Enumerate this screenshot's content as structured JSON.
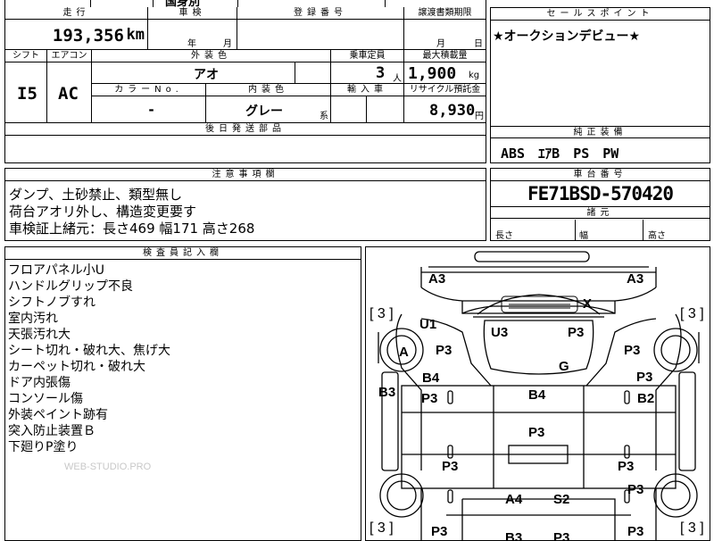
{
  "top_fragment": "国身別",
  "vehicle": {
    "labels": {
      "mileage": "走行",
      "inspection": "車検",
      "registration": "登録番号",
      "transfer_deadline": "譲渡書類期限",
      "shift": "シフト",
      "aircon": "エアコン",
      "exterior_color": "外装色",
      "seating": "乗車定員",
      "max_load": "最大積載量",
      "color_no": "カラーNo.",
      "interior_color": "内装色",
      "import": "輸入車",
      "recycle": "リサイクル預託金",
      "later_parts": "後日発送部品"
    },
    "mileage": "193,356",
    "mileage_unit": "km",
    "inspection_year_unit": "年",
    "inspection_month_unit": "月",
    "transfer_month_unit": "月",
    "transfer_day_unit": "日",
    "shift": "I5",
    "aircon": "AC",
    "exterior_color": "アオ",
    "seating": "3",
    "seating_unit": "人",
    "max_load": "1,900",
    "max_load_unit": "kg",
    "color_no": "-",
    "interior_color": "グレー",
    "interior_suffix": "系",
    "recycle_fee": "8,930",
    "recycle_unit": "円"
  },
  "sales_point": {
    "label": "セールスポイント",
    "text": "★オークションデビュー★"
  },
  "equipment": {
    "label": "純正装備",
    "items": [
      "ABS",
      "ｴｱB",
      "PS",
      "PW"
    ]
  },
  "notes": {
    "label": "注意事項欄",
    "lines": [
      "ダンプ、土砂禁止、類型無し",
      "荷台アオリ外し、構造変更要す",
      "車検証上緒元：長さ469 幅171 高さ268"
    ]
  },
  "chassis": {
    "label": "車台番号",
    "number": "FE71BSD-570420",
    "specs_label": "諸元",
    "length_label": "長さ",
    "width_label": "幅",
    "height_label": "高さ"
  },
  "inspector": {
    "label": "検査員記入欄",
    "lines": [
      "フロアパネル小U",
      "ハンドルグリップ不良",
      "シフトノブすれ",
      "室内汚れ",
      "天張汚れ大",
      "シート切れ・破れ大、焦げ大",
      "カーペット切れ・破れ大",
      "ドア内張傷",
      "コンソール傷",
      "外装ペイント跡有",
      "突入防止装置Ｂ",
      "下廻りP塗り"
    ]
  },
  "watermark": "WEB-STUDIO.PRO",
  "diagram": {
    "tire_grades": [
      "[ 3 ]",
      "[ 3 ]",
      "[ 3 ]",
      "[ 3 ]"
    ],
    "labels": [
      "A3",
      "A3",
      "X",
      "U1",
      "U3",
      "P3",
      "A",
      "P3",
      "P3",
      "G",
      "B4",
      "P3",
      "B3",
      "P3",
      "B4",
      "B2",
      "P3",
      "P3",
      "P3",
      "P3",
      "A4",
      "S2",
      "P3",
      "P3",
      "B3",
      "P3"
    ]
  }
}
